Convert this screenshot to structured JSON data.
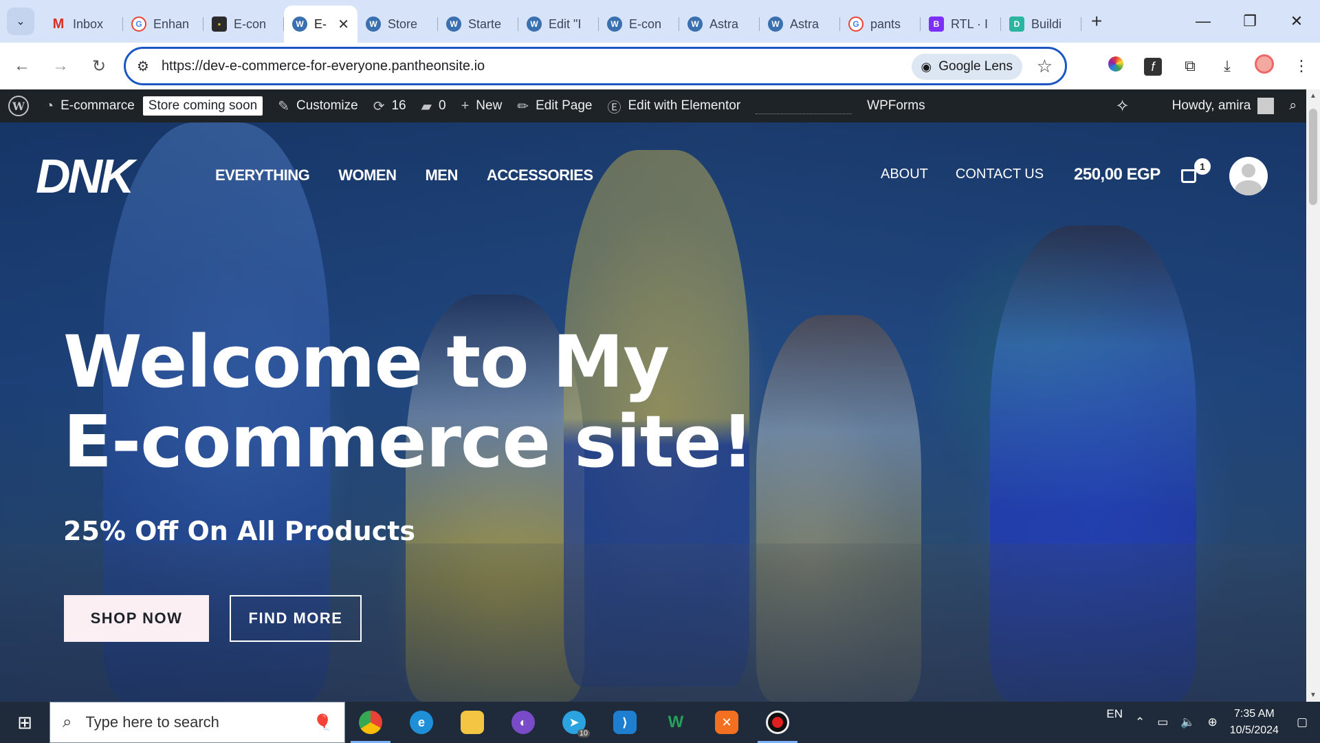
{
  "browser": {
    "tabs": [
      {
        "label": "Inbox",
        "icon": "gmail-icon"
      },
      {
        "label": "Enhan",
        "icon": "google-icon"
      },
      {
        "label": "E-con",
        "icon": "ecommerce-icon"
      },
      {
        "label": "E-",
        "icon": "wordpress-icon",
        "active": true
      },
      {
        "label": "Store",
        "icon": "wordpress-icon"
      },
      {
        "label": "Starte",
        "icon": "wordpress-icon"
      },
      {
        "label": "Edit \"I",
        "icon": "wordpress-icon"
      },
      {
        "label": "E-con",
        "icon": "wordpress-icon"
      },
      {
        "label": "Astra",
        "icon": "wordpress-icon"
      },
      {
        "label": "Astra",
        "icon": "wordpress-icon"
      },
      {
        "label": "pants",
        "icon": "google-icon"
      },
      {
        "label": "RTL · I",
        "icon": "bootstrap-icon"
      },
      {
        "label": "Buildi",
        "icon": "dashboard-icon"
      }
    ],
    "url": "https://dev-e-commerce-for-everyone.pantheonsite.io",
    "lens_label": "Google Lens"
  },
  "adminbar": {
    "site_name": "E-commarce",
    "coming_soon": "Store coming soon",
    "customize": "Customize",
    "updates_count": "16",
    "comments_count": "0",
    "new_label": "New",
    "edit_page": "Edit Page",
    "edit_elementor": "Edit with Elementor",
    "wpforms": "WPForms",
    "howdy": "Howdy, amira"
  },
  "site": {
    "logo": "DNK",
    "menu_left": [
      "EVERYTHING",
      "WOMEN",
      "MEN",
      "ACCESSORIES"
    ],
    "menu_right": [
      "ABOUT",
      "CONTACT US"
    ],
    "cart_total": "250,00 EGP",
    "cart_count": "1"
  },
  "hero": {
    "title_line1": "Welcome to My",
    "title_line2": "E-commerce site!",
    "subtitle": "25% Off On All Products",
    "btn_shop": "SHOP NOW",
    "btn_find": "FIND MORE"
  },
  "taskbar": {
    "search_placeholder": "Type here to search",
    "language": "EN",
    "time": "7:35 AM",
    "date": "10/5/2024",
    "telegram_badge": "10"
  },
  "colors": {
    "admin_bar": "#1d2327",
    "omnibox_border": "#1a56c4",
    "shop_button_bg": "#fbeff4"
  }
}
